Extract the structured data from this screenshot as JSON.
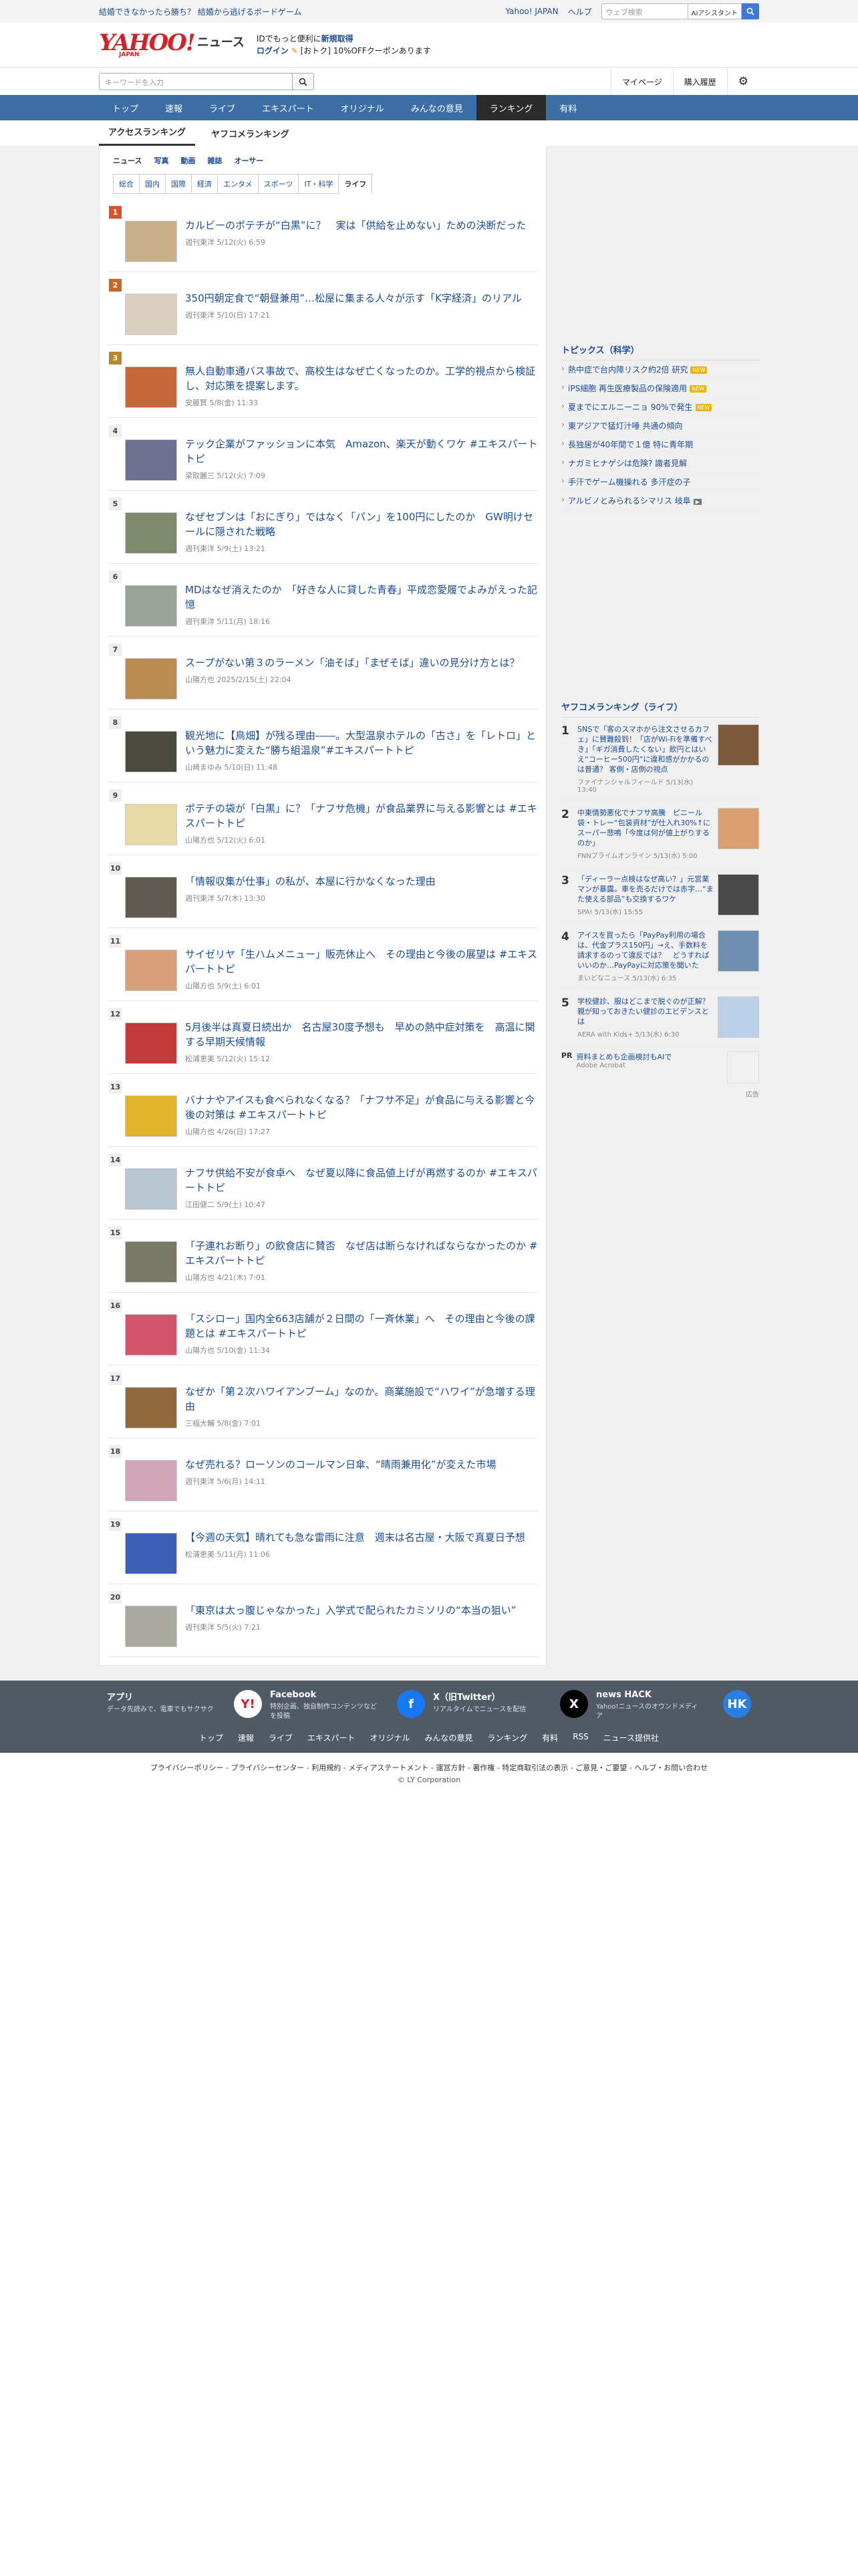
{
  "topbar": {
    "promo": "結婚できなかったら勝ち？ 結婚から逃げるボードゲーム",
    "links": [
      "Yahoo! JAPAN",
      "ヘルプ"
    ],
    "search_placeholder": "ウェブ検索",
    "ai_assist": "AIアシスタント"
  },
  "header": {
    "logo_main": "YAHOO!",
    "logo_sub": "JAPAN",
    "logo_news": "ニュース",
    "member_line1_a": "IDでもっと便利に",
    "member_line1_b": "新規取得",
    "member_line2_a": "ログイン",
    "member_line2_b": "[おトク] 10%OFFクーポンあります"
  },
  "search": {
    "placeholder": "キーワードを入力",
    "right_buttons": [
      "マイページ",
      "購入履歴"
    ]
  },
  "nav": [
    "トップ",
    "速報",
    "ライブ",
    "エキスパート",
    "オリジナル",
    "みんなの意見",
    "ランキング",
    "有料"
  ],
  "nav_active": "ランキング",
  "subtabs": [
    "アクセスランキング",
    "ヤフコメランキング"
  ],
  "categories": [
    "ニュース",
    "写真",
    "動画",
    "雑誌",
    "オーサー"
  ],
  "subcategories": [
    "総合",
    "国内",
    "国際",
    "経済",
    "エンタメ",
    "スポーツ",
    "IT・科学",
    "ライフ"
  ],
  "rankings": [
    {
      "n": "1",
      "title": "カルビーのポテチが“白黒”に？　実は「供給を止めない」ための決断だった",
      "meta": "週刊東洋 5/12(火) 6:59",
      "thumb": "#c9b08a"
    },
    {
      "n": "2",
      "title": "350円朝定食で“朝昼兼用”…松屋に集まる人々が示す「K字経済」のリアル",
      "meta": "週刊東洋 5/10(日) 17:21",
      "thumb": "#d8cfbe"
    },
    {
      "n": "3",
      "title": "無人自動車通バス事故で、高校生はなぜ亡くなったのか。工学的視点から検証し、対応策を提案します。",
      "meta": "安藤賢 5/8(金) 11:33",
      "thumb": "#c46a3a"
    },
    {
      "n": "4",
      "title": "テック企業がファッションに本気　Amazon、楽天が動くワケ #エキスパートトピ",
      "meta": "梁取麗三 5/12(火) 7:09",
      "thumb": "#6c6f8f"
    },
    {
      "n": "5",
      "title": "なぜセブンは「おにぎり」ではなく「パン」を100円にしたのか　GW明けセールに隠された戦略",
      "meta": "週刊東洋 5/9(土) 13:21",
      "thumb": "#7d8a6c"
    },
    {
      "n": "6",
      "title": "MDはなぜ消えたのか　「好きな人に貸した青春」平成恋愛履でよみがえった記憶",
      "meta": "週刊東洋 5/11(月) 18:16",
      "thumb": "#9aa39a"
    },
    {
      "n": "7",
      "title": "スープがない第３のラーメン「油そば」「まぜそば」違いの見分け方とは？",
      "meta": "山陽方也 2025/2/15(土) 22:04",
      "thumb": "#b98d52"
    },
    {
      "n": "8",
      "title": "観光地に【鳥畑】が残る理由――。大型温泉ホテルの「古さ」を「レトロ」という魅力に変えた“勝ち組温泉”#エキスパートトピ",
      "meta": "山崎まゆみ 5/10(日) 11:48",
      "thumb": "#4a4a3c"
    },
    {
      "n": "9",
      "title": "ポテチの袋が「白黒」に？「ナフサ危機」が食品業界に与える影響とは #エキスパートトピ",
      "meta": "山陽方也 5/12(火) 6:01",
      "thumb": "#e8d9a6"
    },
    {
      "n": "10",
      "title": "「情報収集が仕事」の私が、本屋に行かなくなった理由",
      "meta": "週刊東洋 5/7(木) 13:30",
      "thumb": "#5f5b52"
    },
    {
      "n": "11",
      "title": "サイゼリヤ「生ハムメニュー」販売休止へ　その理由と今後の展望は #エキスパートトピ",
      "meta": "山陽方也 5/9(土) 6:01",
      "thumb": "#d7a07a"
    },
    {
      "n": "12",
      "title": "5月後半は真夏日続出か　名古屋30度予想も　早めの熱中症対策を　高温に関する早期天候情報",
      "meta": "松浦恵美 5/12(火) 15:12",
      "thumb": "#c43a3a"
    },
    {
      "n": "13",
      "title": "バナナやアイスも食べられなくなる？「ナフサ不足」が食品に与える影響と今後の対策は #エキスパートトピ",
      "meta": "山陽方也 4/26(日) 17:27",
      "thumb": "#e0b32a"
    },
    {
      "n": "14",
      "title": "ナフサ供給不安が食卓へ　なぜ夏以降に食品値上げが再燃するのか #エキスパートトピ",
      "meta": "江田健二 5/9(土) 10:47",
      "thumb": "#b8c6d2"
    },
    {
      "n": "15",
      "title": "「子連れお断り」の飲食店に賛否　なぜ店は断らなければならなかったのか #エキスパートトピ",
      "meta": "山陽方也 4/21(木) 7:01",
      "thumb": "#7a7866"
    },
    {
      "n": "16",
      "title": "「スシロー」国内全663店舗が２日間の「一斉休業」へ　その理由と今後の課題とは #エキスパートトピ",
      "meta": "山陽方也 5/10(金) 11:34",
      "thumb": "#d3536b"
    },
    {
      "n": "17",
      "title": "なぜか「第２次ハワイアンブーム」なのか。商業施設で“ハワイ”が急増する理由",
      "meta": "三福大輔 5/8(金) 7:01",
      "thumb": "#8e6a3c"
    },
    {
      "n": "18",
      "title": "なぜ売れる？ローソンのコールマン日傘、“晴雨兼用化”が変えた市場",
      "meta": "週刊東洋 5/6(月) 14:11",
      "thumb": "#cfa6b8"
    },
    {
      "n": "19",
      "title": "【今週の天気】晴れても急な雷雨に注意　週末は名古屋・大阪で真夏日予想",
      "meta": "松浦恵美 5/11(月) 11:06",
      "thumb": "#3d5fb4"
    },
    {
      "n": "20",
      "title": "「東京は太っ腹じゃなかった」入学式で配られたカミソリの“本当の狙い”",
      "meta": "週刊東洋 5/5(火) 7:21",
      "thumb": "#a9a9a0"
    }
  ],
  "topics": {
    "title": "トピックス（科学）",
    "items": [
      {
        "t": "熱中症で台内障リスク約2倍 研究",
        "tag": "NEW"
      },
      {
        "t": "iPS細胞 再生医療製品の保険適用",
        "tag": "NEW"
      },
      {
        "t": "夏までにエルニーニョ 90%で発生",
        "tag": "NEW"
      },
      {
        "t": "東アジアで猛灯汁唾 共通の傾向",
        "tag": ""
      },
      {
        "t": "長独居が40年間で１億 特に青年期",
        "tag": ""
      },
      {
        "t": "ナガミヒナゲシは危険? 識者見解",
        "tag": ""
      },
      {
        "t": "手汗でゲーム機操れる 多汗症の子",
        "tag": ""
      },
      {
        "t": "アルビノとみられるシマリス 岐阜",
        "tag": "cam"
      }
    ]
  },
  "yafucome": {
    "title": "ヤフコメランキング（ライフ）",
    "items": [
      {
        "n": "1",
        "t": "SNSで「客のスマホから注文させるカフェ」に賛難殺到！「店がWi-Fiを準備すべき」「ギガ消費したくない」飲円とはいえ“コーヒー500円”に違和感がかかるのは普通？ 客側・店側の視点",
        "m": "ファイナンシャルフィールド 5/13(水) 13:40",
        "th": "#7b5b3c"
      },
      {
        "n": "2",
        "t": "中東情勢悪化でナフサ高騰　ピニール袋・トレー“包装資材”が仕入れ30%↑にスーパー悲鳴「今度は何が値上がりするのか」",
        "m": "FNNプライムオンライン 5/13(水) 5:00",
        "th": "#d8a06e"
      },
      {
        "n": "3",
        "t": "「ディーラー点検はなぜ高い？」元営業マンが暴露。車を売るだけでは赤字…“また使える部品”も交換するワケ",
        "m": "SPA! 5/13(水) 15:55",
        "th": "#4a4a4a"
      },
      {
        "n": "4",
        "t": "アイスを買ったら「PayPay利用の場合は、代金プラス150円」→え、手数料を請求するのって違反では？　どうすればいいのか…PayPayに対応策を聞いた",
        "m": "まいどなニュース 5/13(水) 6:35",
        "th": "#6f8fb0"
      },
      {
        "n": "5",
        "t": "学校健診、服はどこまで脱ぐのが正解？　親が知っておきたい健診のエビデンスとは",
        "m": "AERA with Kids+ 5/13(水) 6:30",
        "th": "#b9d0e8"
      }
    ]
  },
  "pr": {
    "label": "PR",
    "title": "資料まとめも企画検討もAIで",
    "sponsor": "Adobe Acrobat",
    "note": "広告"
  },
  "apps": [
    {
      "h": "アプリ",
      "d": "データ先読みで、電車でもサクサク",
      "ic": "Y!",
      "c": "#ffffff",
      "fc": "#d1232a"
    },
    {
      "h": "Facebook",
      "d": "特別企画、独自制作コンテンツなどを投稿",
      "ic": "f",
      "c": "#1877f2",
      "fc": "#ffffff"
    },
    {
      "h": "X（旧Twitter）",
      "d": "リアルタイムでニュースを配信",
      "ic": "X",
      "c": "#000000",
      "fc": "#ffffff"
    },
    {
      "h": "news HACK",
      "d": "Yahoo!ニュースのオウンドメディア",
      "ic": "HK",
      "c": "#2a7de1",
      "fc": "#ffffff"
    }
  ],
  "footnav": [
    "トップ",
    "速報",
    "ライブ",
    "エキスパート",
    "オリジナル",
    "みんなの意見",
    "ランキング",
    "有料",
    "RSS",
    "ニュース提供社"
  ],
  "legal": "プライバシーポリシー - プライバシーセンター - 利用規約 - メディアステートメント - 運営方針 - 著作権 - 特定商取引法の表示 - ご意見・ご要望 - ヘルプ・お問い合わせ",
  "copyright": "© LY Corporation"
}
